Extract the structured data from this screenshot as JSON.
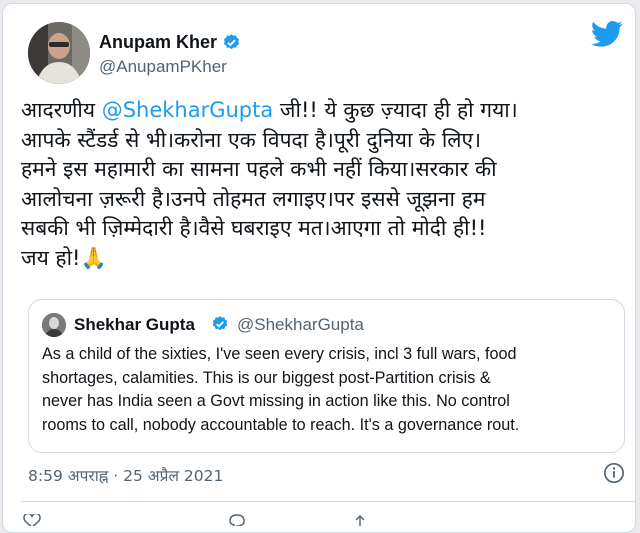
{
  "author": {
    "name": "Anupam Kher",
    "handle": "@AnupamPKher"
  },
  "tweet": {
    "lines": [
      {
        "before": "आदरणीय ",
        "mention": "@ShekharGupta",
        "after": " जी!! ये कुछ ज़्यादा ही हो गया।"
      },
      {
        "text": "आपके स्टैंडर्ड से भी।करोना एक विपदा है।पूरी दुनिया के लिए।"
      },
      {
        "text": "हमने इस महामारी का सामना पहले कभी नहीं किया।सरकार की"
      },
      {
        "text": "आलोचना ज़रूरी है।उनपे तोहमत लगाइए।पर इससे जूझना हम"
      },
      {
        "text": "सबकी भी ज़िम्मेदारी है।वैसे घबराइए मत।आएगा तो मोदी ही!!"
      },
      {
        "text": "जय हो!🙏"
      }
    ]
  },
  "quote": {
    "name": "Shekhar Gupta",
    "handle": "@ShekharGupta",
    "lines": [
      "As a child of the sixties, I've seen every crisis, incl 3 full wars, food",
      "shortages, calamities. This is our biggest post-Partition crisis &",
      "never has India seen a Govt missing in action like this. No control",
      "rooms to call, nobody accountable to reach. It's a governance rout."
    ]
  },
  "meta": {
    "timestamp": "8:59 अपराह्न · 25 अप्रैल 2021"
  },
  "colors": {
    "link": "#1d9bf0",
    "secondary": "#536471",
    "text": "#0f1419"
  }
}
